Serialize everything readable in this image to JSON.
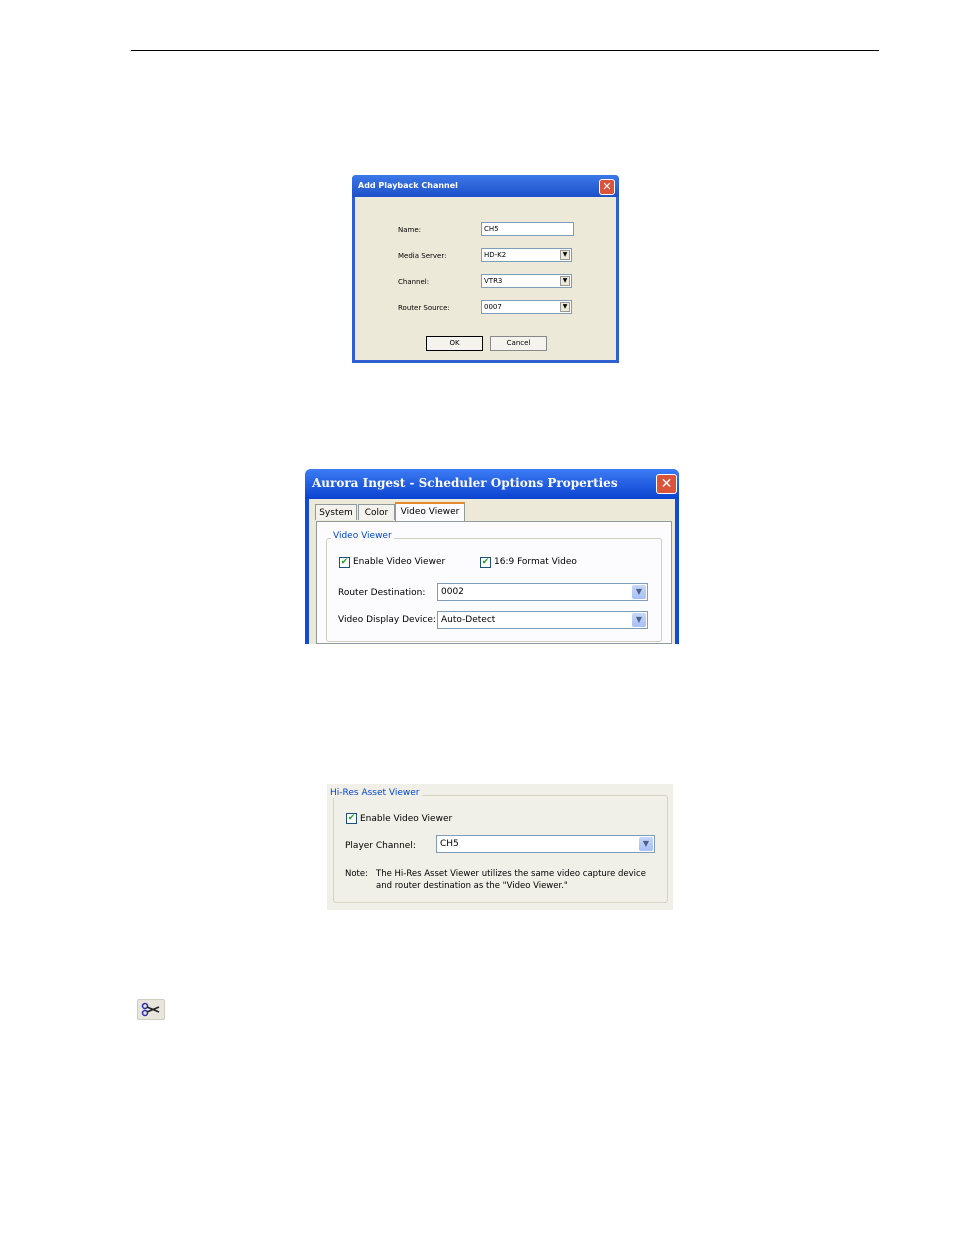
{
  "dialog1": {
    "title": "Add Playback Channel",
    "close_symbol": "✕",
    "fields": {
      "name_label": "Name:",
      "name_value": "CH5",
      "media_server_label": "Media Server:",
      "media_server_value": "HD-K2",
      "channel_label": "Channel:",
      "channel_value": "VTR3",
      "router_source_label": "Router Source:",
      "router_source_value": "0007"
    },
    "ok_label": "OK",
    "cancel_label": "Cancel"
  },
  "dialog2": {
    "title": "Aurora Ingest - Scheduler Options Properties",
    "close_symbol": "✕",
    "tabs": [
      "System",
      "Color",
      "Video Viewer"
    ],
    "active_tab": "Video Viewer",
    "group_title": "Video Viewer",
    "enable_video_viewer_label": "Enable Video Viewer",
    "enable_video_viewer_checked": true,
    "format_169_label": "16:9 Format Video",
    "format_169_checked": true,
    "router_destination_label": "Router Destination:",
    "router_destination_value": "0002",
    "video_display_device_label": "Video Display Device:",
    "video_display_device_value": "Auto-Detect"
  },
  "panel3": {
    "group_title": "Hi-Res Asset Viewer",
    "enable_video_viewer_label": "Enable Video Viewer",
    "enable_video_viewer_checked": true,
    "player_channel_label": "Player Channel:",
    "player_channel_value": "CH5",
    "note_label": "Note:",
    "note_line1": "The Hi-Res Asset Viewer utilizes the same video capture device",
    "note_line2": "and router destination as the \"Video Viewer.\""
  },
  "toolbar_icon": "scissors-icon",
  "colors": {
    "xp_title_blue": "#0f4ad8",
    "dialog_face": "#ece9d8",
    "group_blue": "#0046d5",
    "close_red": "#d9543a"
  }
}
